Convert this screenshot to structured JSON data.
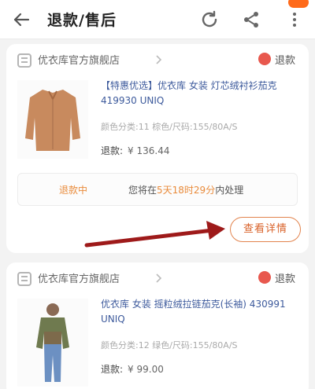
{
  "header": {
    "title": "退款/售后",
    "icons": [
      "arrow-left-icon",
      "refresh-icon",
      "share-icon",
      "more-icon"
    ],
    "accent": "#ff6a1a"
  },
  "orders": [
    {
      "store_name": "优衣库官方旗舰店",
      "status": "退款",
      "product_title": "【特惠优选】优衣库 女装 灯芯绒衬衫茄克 419930 UNIQ",
      "spec": "颜色分类:11 棕色/尺码:155/80A/S",
      "amount_label": "退款:",
      "amount": "¥ 136.44",
      "progress_status": "退款中",
      "progress_text_prefix": "您将在",
      "progress_deadline": "5天18时29分",
      "progress_text_suffix": "内处理"
    },
    {
      "store_name": "优衣库官方旗舰店",
      "status": "退款",
      "product_title": "优衣库 女装 摇粒绒拉链茄克(长袖) 430991 UNIQ",
      "spec": "颜色分类:12 绿色/尺码:155/80A/S",
      "amount_label": "退款:",
      "amount": "¥ 99.00"
    }
  ],
  "detail_button_label": "查看详情",
  "annotation_arrow_color": "#9e1a1a"
}
